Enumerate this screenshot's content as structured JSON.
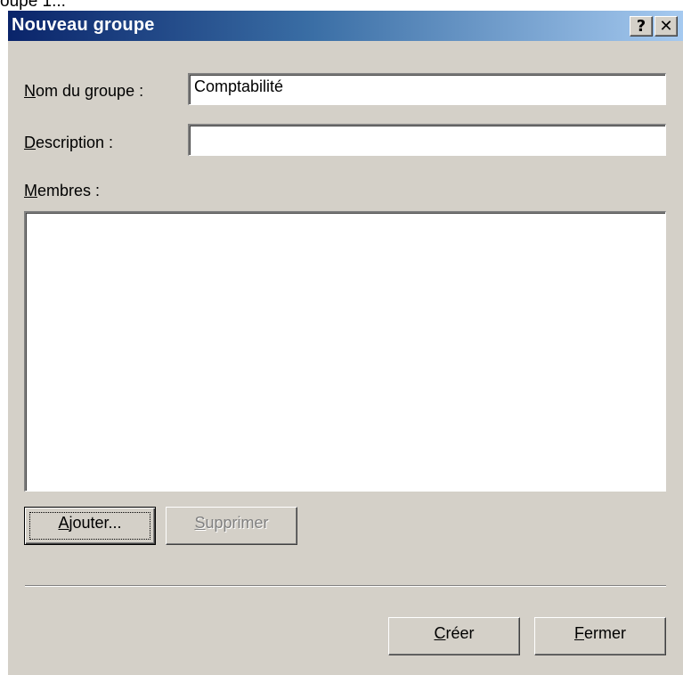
{
  "snippet": "oupe 1...",
  "window": {
    "title": "Nouveau groupe",
    "help_glyph": "?",
    "close_glyph": "✕"
  },
  "form": {
    "name_label_key": "N",
    "name_label_rest": "om du groupe :",
    "name_value": "Comptabilité",
    "description_label_key": "D",
    "description_label_rest": "escription :",
    "description_value": "",
    "members_label_key": "M",
    "members_label_rest": "embres :",
    "members": []
  },
  "buttons": {
    "add_key": "A",
    "add_rest": "jouter...",
    "remove_key": "S",
    "remove_rest": "upprimer",
    "create_key": "C",
    "create_rest": "réer",
    "close_key": "F",
    "close_rest": "ermer"
  }
}
